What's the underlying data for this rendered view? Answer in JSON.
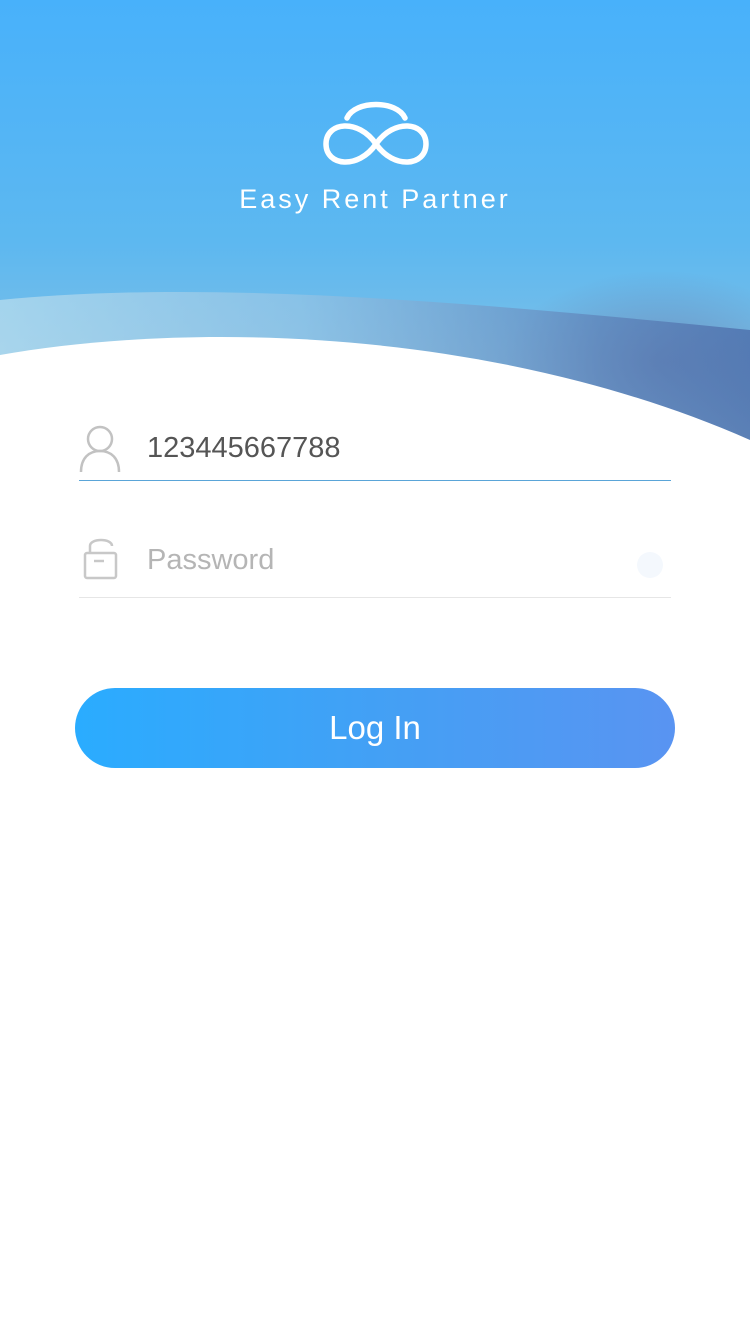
{
  "app": {
    "name": "Easy Rent Partner"
  },
  "login_form": {
    "username_value": "123445667788",
    "password_placeholder": "Password",
    "submit_label": "Log In"
  },
  "icons": {
    "logo": "infinity-cloud-logo",
    "username": "user-icon",
    "password": "lock-icon",
    "password_toggle": "eye-toggle-icon"
  },
  "colors": {
    "header_top": "#48b1fb",
    "header_bottom": "#7fbde8",
    "button_start": "#2aacff",
    "button_end": "#5994f2",
    "active_underline": "#5aa5d8"
  }
}
